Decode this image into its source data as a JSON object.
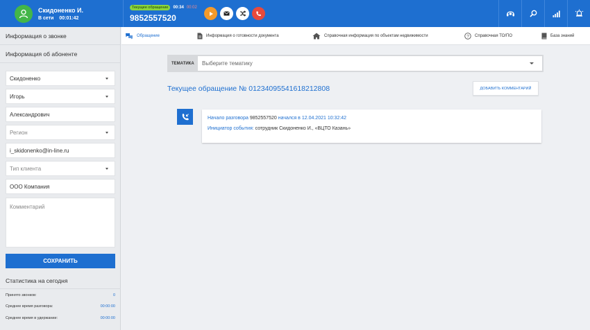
{
  "user": {
    "name": "Скидоненко И.",
    "status": "В сети",
    "time": "00:01:42"
  },
  "call": {
    "badge": "Текущее обращение",
    "time": "00:34",
    "time2": "00:02",
    "number": "9852557520"
  },
  "tabs": [
    {
      "label": "Обращение"
    },
    {
      "label": "Информация о готовности документа"
    },
    {
      "label": "Справочная информация по объектам недвижимости"
    },
    {
      "label": "Справочная ТО/ПО"
    },
    {
      "label": "База знаний"
    }
  ],
  "sidebar": {
    "call_info": "Информация о звонке",
    "subscriber_info": "Информация об абоненте",
    "fields": {
      "last_name": "Скидоненко",
      "first_name": "Игорь",
      "middle_name": "Александрович",
      "region": "Регион",
      "email": "i_skidonenko@in-line.ru",
      "client_type": "Тип клиента",
      "company": "ООО Компания",
      "comment": "Комментарий"
    },
    "save_label": "СОХРАНИТЬ",
    "stats_title": "Статистика на сегодня",
    "stats": [
      {
        "label": "Принято звонков:",
        "value": "0"
      },
      {
        "label": "Среднее время разговора:",
        "value": "00:00:00"
      },
      {
        "label": "Среднее время в удержании:",
        "value": "00:00:00"
      }
    ]
  },
  "main": {
    "topic_label": "ТЕМАТИКА",
    "topic_placeholder": "Выберите тематику",
    "appeal_title": "Текущее обращение № 01234095541618212808",
    "add_comment": "ДОБАВИТЬ КОММЕНТАРИЙ",
    "event": {
      "l1a": "Начало разговора",
      "l1b": "9852557520",
      "l1c": "начался в 12.04.2021 10:32:42",
      "l2a": "Инициатор события:",
      "l2b": "сотрудник Скидоненко И., «ВЦТО Казань»"
    }
  },
  "colors": {
    "brand": "#1e6fd0",
    "online": "#43b649",
    "accent_orange": "#f49a2a",
    "danger": "#e84a3c"
  }
}
